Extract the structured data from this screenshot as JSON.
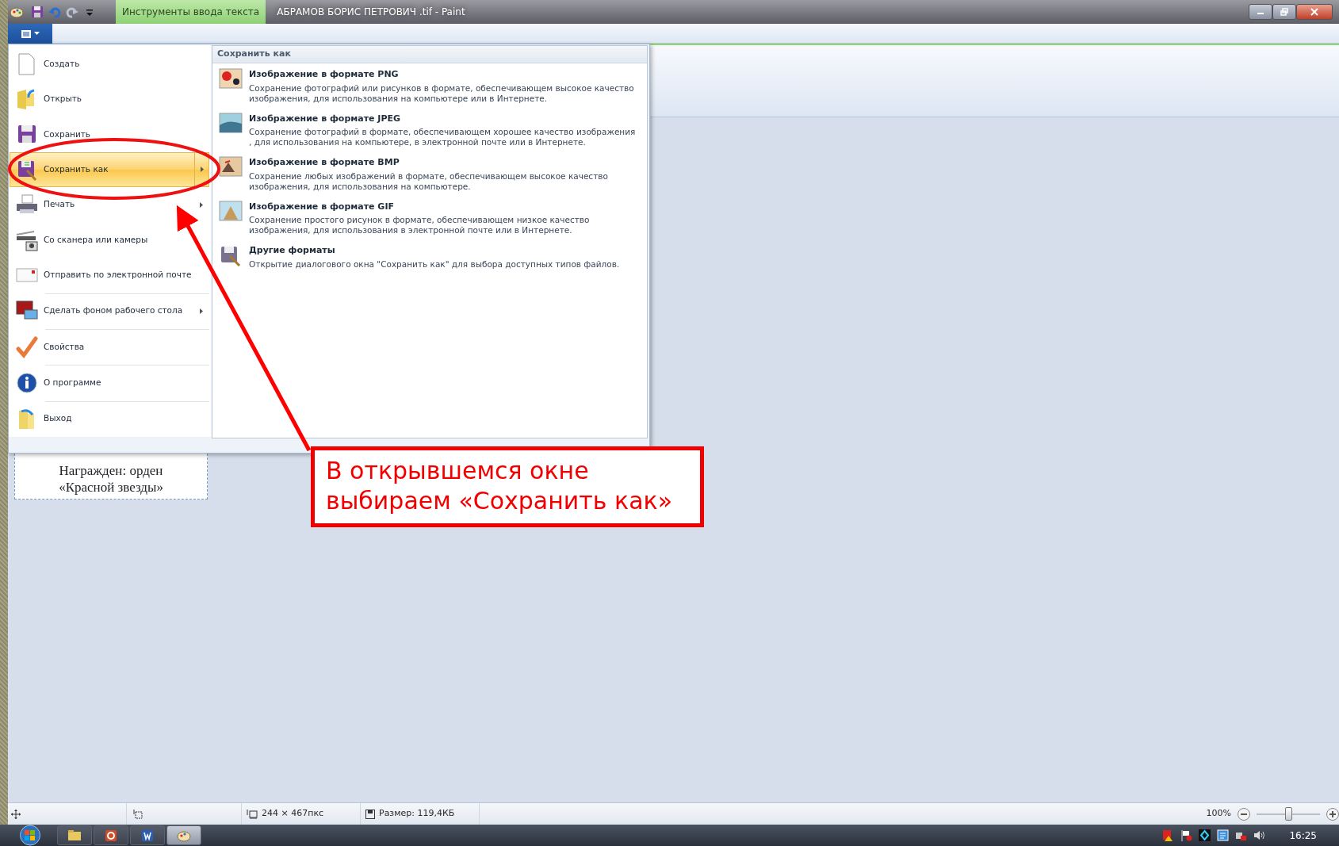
{
  "window": {
    "contextual_tab": "Инструменты ввода текста",
    "title": "АБРАМОВ БОРИС ПЕТРОВИЧ .tif - Paint"
  },
  "file_menu": {
    "items": [
      {
        "label": "Создать",
        "kind": "new",
        "has_submenu": false,
        "separator_before": false,
        "selected": false
      },
      {
        "label": "Открыть",
        "kind": "open",
        "has_submenu": false,
        "separator_before": false,
        "selected": false
      },
      {
        "label": "Сохранить",
        "kind": "save",
        "has_submenu": false,
        "separator_before": false,
        "selected": false
      },
      {
        "label": "Сохранить как",
        "kind": "saveas",
        "has_submenu": true,
        "separator_before": false,
        "selected": true
      },
      {
        "label": "Печать",
        "kind": "print",
        "has_submenu": true,
        "separator_before": false,
        "selected": false
      },
      {
        "label": "Со сканера или камеры",
        "kind": "scan",
        "has_submenu": false,
        "separator_before": false,
        "selected": false
      },
      {
        "label": "Отправить по электронной почте",
        "kind": "mail",
        "has_submenu": false,
        "separator_before": false,
        "selected": false
      },
      {
        "label": "Сделать фоном рабочего стола",
        "kind": "desktop",
        "has_submenu": true,
        "separator_before": true,
        "selected": false
      },
      {
        "label": "Свойства",
        "kind": "props",
        "has_submenu": false,
        "separator_before": true,
        "selected": false
      },
      {
        "label": "О программе",
        "kind": "about",
        "has_submenu": false,
        "separator_before": true,
        "selected": false
      },
      {
        "label": "Выход",
        "kind": "exit",
        "has_submenu": false,
        "separator_before": true,
        "selected": false
      }
    ]
  },
  "submenu": {
    "title": "Сохранить как",
    "items": [
      {
        "kind": "png",
        "title": "Изображение в формате PNG",
        "description": "Сохранение фотографий или рисунков в формате, обеспечивающем высокое качество изображения, для использования на компьютере или в Интернете."
      },
      {
        "kind": "jpeg",
        "title": "Изображение в формате JPEG",
        "description": "Сохранение фотографий в формате, обеспечивающем хорошее качество изображения , для использования на компьютере, в электронной почте или в Интернете."
      },
      {
        "kind": "bmp",
        "title": "Изображение в формате BMP",
        "description": "Сохранение любых изображений в формате, обеспечивающем высокое качество изображения, для использования на компьютере."
      },
      {
        "kind": "gif",
        "title": "Изображение в формате GIF",
        "description": "Сохранение простого рисунок в формате, обеспечивающем низкое качество изображения, для использования в электронной почте или в Интернете."
      },
      {
        "kind": "other",
        "title": "Другие форматы",
        "description": "Открытие диалогового окна \"Сохранить как\" для выбора доступных типов файлов."
      }
    ]
  },
  "canvas": {
    "text_lines": [
      "Награжден: орден",
      "«Красной звезды»"
    ]
  },
  "annotation": {
    "text": "В открывшемся окне выбираем «Сохранить как»"
  },
  "status_bar": {
    "dimensions": "244 × 467пкс",
    "size": "Размер: 119,4КБ",
    "zoom": "100%",
    "zoom_slider": {
      "level": 0.5
    }
  },
  "taskbar": {
    "apps": [
      {
        "kind": "explorer",
        "selected": false
      },
      {
        "kind": "presentation",
        "selected": false
      },
      {
        "kind": "word",
        "selected": false
      },
      {
        "kind": "paint",
        "selected": true
      }
    ],
    "clock": "16:25"
  }
}
